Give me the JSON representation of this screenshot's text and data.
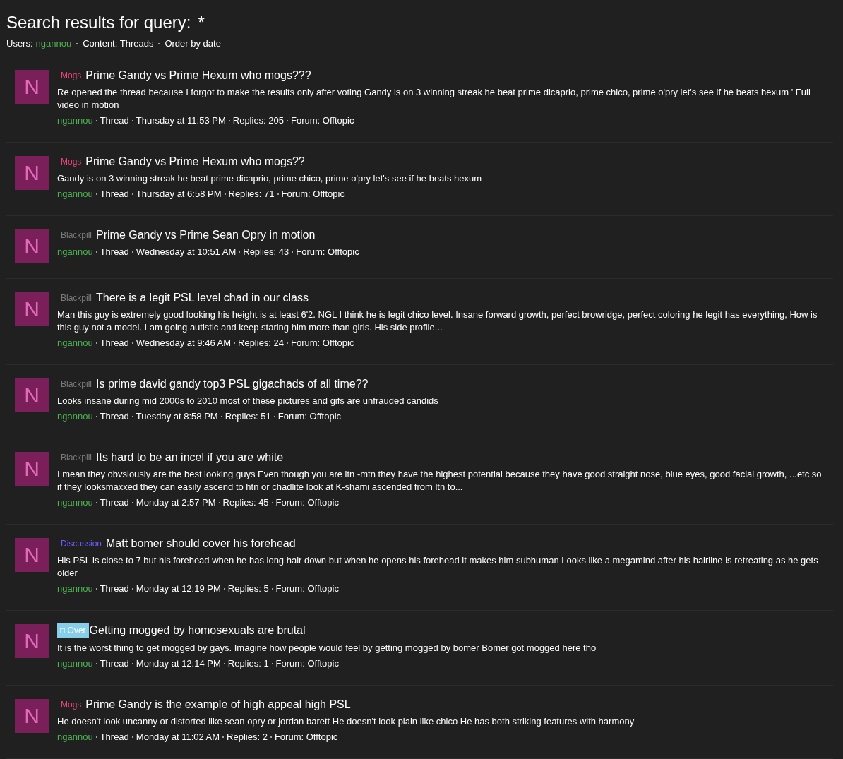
{
  "title": "Search results for query:",
  "query": "*",
  "filters": {
    "users_label": "Users:",
    "user": "ngannou",
    "content": "Content: Threads",
    "order": "Order by date"
  },
  "results": [
    {
      "avatar": "N",
      "prefix": {
        "text": "Mogs",
        "kind": "text",
        "color": "#e8457a"
      },
      "title": "Prime Gandy vs Prime Hexum who mogs???",
      "snippet": "Re opened the thread because I forgot to make the results only after voting Gandy is on 3 winning streak he beat prime dicaprio, prime chico, prime o'pry let's see if he beats hexum ' Full video in motion",
      "user": "ngannou",
      "type": "Thread",
      "date": "Thursday at 11:53 PM",
      "replies": "Replies: 205",
      "forum": "Forum: Offtopic"
    },
    {
      "avatar": "N",
      "prefix": {
        "text": "Mogs",
        "kind": "text",
        "color": "#e8457a"
      },
      "title": "Prime Gandy vs Prime Hexum who mogs??",
      "snippet": "Gandy is on 3 winning streak he beat prime dicaprio, prime chico, prime o'pry let's see if he beats hexum",
      "user": "ngannou",
      "type": "Thread",
      "date": "Thursday at 6:58 PM",
      "replies": "Replies: 71",
      "forum": "Forum: Offtopic"
    },
    {
      "avatar": "N",
      "prefix": {
        "text": "Blackpill",
        "kind": "text",
        "color": "#7a7a7a"
      },
      "title": "Prime Gandy vs Prime Sean Opry in motion",
      "user": "ngannou",
      "type": "Thread",
      "date": "Wednesday at 10:51 AM",
      "replies": "Replies: 43",
      "forum": "Forum: Offtopic"
    },
    {
      "avatar": "N",
      "prefix": {
        "text": "Blackpill",
        "kind": "text",
        "color": "#7a7a7a"
      },
      "title": "There is a legit PSL level chad in our class",
      "snippet": "Man this guy is extremely good looking his height is at least 6'2. NGL I think he is legit chico level. Insane forward growth, perfect browridge, perfect coloring he legit has everything, How is this guy not a model. I am going autistic and keep staring him more than girls. His side profile...",
      "user": "ngannou",
      "type": "Thread",
      "date": "Wednesday at 9:46 AM",
      "replies": "Replies: 24",
      "forum": "Forum: Offtopic"
    },
    {
      "avatar": "N",
      "prefix": {
        "text": "Blackpill",
        "kind": "text",
        "color": "#7a7a7a"
      },
      "title": "Is prime david gandy top3 PSL gigachads of all time??",
      "snippet": "Looks insane during mid 2000s to 2010 most of these pictures and gifs are unfrauded candids",
      "user": "ngannou",
      "type": "Thread",
      "date": "Tuesday at 8:58 PM",
      "replies": "Replies: 51",
      "forum": "Forum: Offtopic"
    },
    {
      "avatar": "N",
      "prefix": {
        "text": "Blackpill",
        "kind": "text",
        "color": "#7a7a7a"
      },
      "title": "Its hard to be an incel if you are white",
      "snippet": "I mean they obvsiously are the best looking guys Even though you are ltn -mtn they have the highest potential because they have good straight nose, blue eyes, good facial growth, ...etc so if they looksmaxxed they can easily ascend to htn or chadlite look at K-shami ascended from ltn to...",
      "user": "ngannou",
      "type": "Thread",
      "date": "Monday at 2:57 PM",
      "replies": "Replies: 45",
      "forum": "Forum: Offtopic"
    },
    {
      "avatar": "N",
      "prefix": {
        "text": "Discussion",
        "kind": "text",
        "color": "#6b5bff"
      },
      "title": "Matt bomer should cover his forehead",
      "snippet": "His PSL is close to 7 but his forehead when he has long hair down but when he opens his forehead it makes him subhuman Looks like a megamind after his hairline is retreating as he gets older",
      "user": "ngannou",
      "type": "Thread",
      "date": "Monday at 12:19 PM",
      "replies": "Replies: 5",
      "forum": "Forum: Offtopic"
    },
    {
      "avatar": "N",
      "prefix": {
        "text": "□ Over",
        "kind": "badge",
        "color": "#87ceeb"
      },
      "title": "Getting mogged by homosexuals are brutal",
      "snippet": "It is the worst thing to get mogged by gays. Imagine how people would feel by getting mogged by bomer Bomer got mogged here tho",
      "user": "ngannou",
      "type": "Thread",
      "date": "Monday at 12:14 PM",
      "replies": "Replies: 1",
      "forum": "Forum: Offtopic"
    },
    {
      "avatar": "N",
      "prefix": {
        "text": "Mogs",
        "kind": "text",
        "color": "#e8457a"
      },
      "title": "Prime Gandy is the example of high appeal high PSL",
      "snippet": "He doesn't look uncanny or distorted like sean opry or jordan barett He doesn't look plain like chico He has both striking features with harmony",
      "user": "ngannou",
      "type": "Thread",
      "date": "Monday at 11:02 AM",
      "replies": "Replies: 2",
      "forum": "Forum: Offtopic"
    }
  ]
}
